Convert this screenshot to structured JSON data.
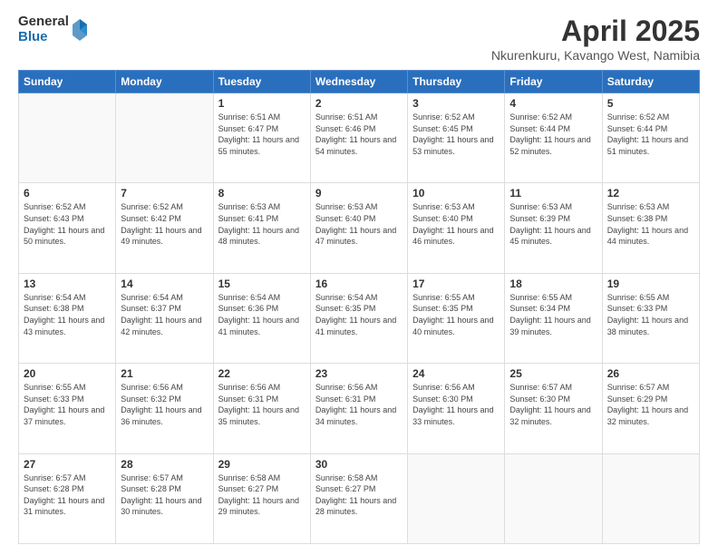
{
  "header": {
    "logo_general": "General",
    "logo_blue": "Blue",
    "month_year": "April 2025",
    "location": "Nkurenkuru, Kavango West, Namibia"
  },
  "days_of_week": [
    "Sunday",
    "Monday",
    "Tuesday",
    "Wednesday",
    "Thursday",
    "Friday",
    "Saturday"
  ],
  "weeks": [
    [
      {
        "day": "",
        "detail": ""
      },
      {
        "day": "",
        "detail": ""
      },
      {
        "day": "1",
        "detail": "Sunrise: 6:51 AM\nSunset: 6:47 PM\nDaylight: 11 hours\nand 55 minutes."
      },
      {
        "day": "2",
        "detail": "Sunrise: 6:51 AM\nSunset: 6:46 PM\nDaylight: 11 hours\nand 54 minutes."
      },
      {
        "day": "3",
        "detail": "Sunrise: 6:52 AM\nSunset: 6:45 PM\nDaylight: 11 hours\nand 53 minutes."
      },
      {
        "day": "4",
        "detail": "Sunrise: 6:52 AM\nSunset: 6:44 PM\nDaylight: 11 hours\nand 52 minutes."
      },
      {
        "day": "5",
        "detail": "Sunrise: 6:52 AM\nSunset: 6:44 PM\nDaylight: 11 hours\nand 51 minutes."
      }
    ],
    [
      {
        "day": "6",
        "detail": "Sunrise: 6:52 AM\nSunset: 6:43 PM\nDaylight: 11 hours\nand 50 minutes."
      },
      {
        "day": "7",
        "detail": "Sunrise: 6:52 AM\nSunset: 6:42 PM\nDaylight: 11 hours\nand 49 minutes."
      },
      {
        "day": "8",
        "detail": "Sunrise: 6:53 AM\nSunset: 6:41 PM\nDaylight: 11 hours\nand 48 minutes."
      },
      {
        "day": "9",
        "detail": "Sunrise: 6:53 AM\nSunset: 6:40 PM\nDaylight: 11 hours\nand 47 minutes."
      },
      {
        "day": "10",
        "detail": "Sunrise: 6:53 AM\nSunset: 6:40 PM\nDaylight: 11 hours\nand 46 minutes."
      },
      {
        "day": "11",
        "detail": "Sunrise: 6:53 AM\nSunset: 6:39 PM\nDaylight: 11 hours\nand 45 minutes."
      },
      {
        "day": "12",
        "detail": "Sunrise: 6:53 AM\nSunset: 6:38 PM\nDaylight: 11 hours\nand 44 minutes."
      }
    ],
    [
      {
        "day": "13",
        "detail": "Sunrise: 6:54 AM\nSunset: 6:38 PM\nDaylight: 11 hours\nand 43 minutes."
      },
      {
        "day": "14",
        "detail": "Sunrise: 6:54 AM\nSunset: 6:37 PM\nDaylight: 11 hours\nand 42 minutes."
      },
      {
        "day": "15",
        "detail": "Sunrise: 6:54 AM\nSunset: 6:36 PM\nDaylight: 11 hours\nand 41 minutes."
      },
      {
        "day": "16",
        "detail": "Sunrise: 6:54 AM\nSunset: 6:35 PM\nDaylight: 11 hours\nand 41 minutes."
      },
      {
        "day": "17",
        "detail": "Sunrise: 6:55 AM\nSunset: 6:35 PM\nDaylight: 11 hours\nand 40 minutes."
      },
      {
        "day": "18",
        "detail": "Sunrise: 6:55 AM\nSunset: 6:34 PM\nDaylight: 11 hours\nand 39 minutes."
      },
      {
        "day": "19",
        "detail": "Sunrise: 6:55 AM\nSunset: 6:33 PM\nDaylight: 11 hours\nand 38 minutes."
      }
    ],
    [
      {
        "day": "20",
        "detail": "Sunrise: 6:55 AM\nSunset: 6:33 PM\nDaylight: 11 hours\nand 37 minutes."
      },
      {
        "day": "21",
        "detail": "Sunrise: 6:56 AM\nSunset: 6:32 PM\nDaylight: 11 hours\nand 36 minutes."
      },
      {
        "day": "22",
        "detail": "Sunrise: 6:56 AM\nSunset: 6:31 PM\nDaylight: 11 hours\nand 35 minutes."
      },
      {
        "day": "23",
        "detail": "Sunrise: 6:56 AM\nSunset: 6:31 PM\nDaylight: 11 hours\nand 34 minutes."
      },
      {
        "day": "24",
        "detail": "Sunrise: 6:56 AM\nSunset: 6:30 PM\nDaylight: 11 hours\nand 33 minutes."
      },
      {
        "day": "25",
        "detail": "Sunrise: 6:57 AM\nSunset: 6:30 PM\nDaylight: 11 hours\nand 32 minutes."
      },
      {
        "day": "26",
        "detail": "Sunrise: 6:57 AM\nSunset: 6:29 PM\nDaylight: 11 hours\nand 32 minutes."
      }
    ],
    [
      {
        "day": "27",
        "detail": "Sunrise: 6:57 AM\nSunset: 6:28 PM\nDaylight: 11 hours\nand 31 minutes."
      },
      {
        "day": "28",
        "detail": "Sunrise: 6:57 AM\nSunset: 6:28 PM\nDaylight: 11 hours\nand 30 minutes."
      },
      {
        "day": "29",
        "detail": "Sunrise: 6:58 AM\nSunset: 6:27 PM\nDaylight: 11 hours\nand 29 minutes."
      },
      {
        "day": "30",
        "detail": "Sunrise: 6:58 AM\nSunset: 6:27 PM\nDaylight: 11 hours\nand 28 minutes."
      },
      {
        "day": "",
        "detail": ""
      },
      {
        "day": "",
        "detail": ""
      },
      {
        "day": "",
        "detail": ""
      }
    ]
  ]
}
